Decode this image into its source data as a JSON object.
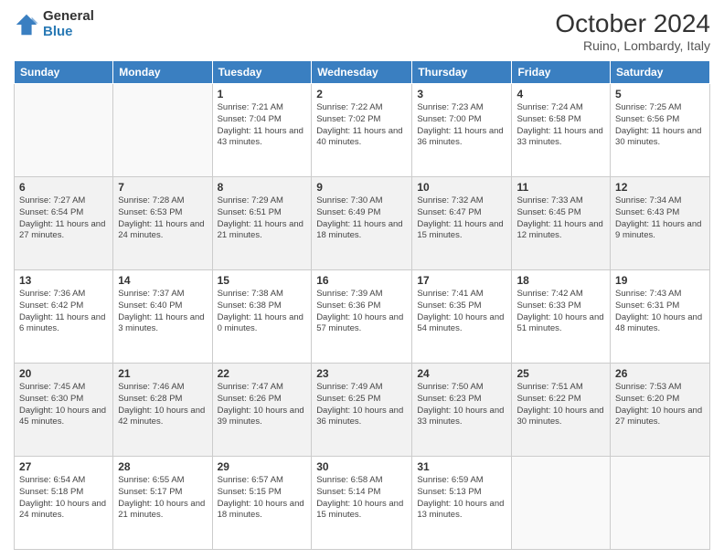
{
  "logo": {
    "general": "General",
    "blue": "Blue"
  },
  "header": {
    "title": "October 2024",
    "subtitle": "Ruino, Lombardy, Italy"
  },
  "weekdays": [
    "Sunday",
    "Monday",
    "Tuesday",
    "Wednesday",
    "Thursday",
    "Friday",
    "Saturday"
  ],
  "weeks": [
    [
      {
        "day": "",
        "sunrise": "",
        "sunset": "",
        "daylight": ""
      },
      {
        "day": "",
        "sunrise": "",
        "sunset": "",
        "daylight": ""
      },
      {
        "day": "1",
        "sunrise": "Sunrise: 7:21 AM",
        "sunset": "Sunset: 7:04 PM",
        "daylight": "Daylight: 11 hours and 43 minutes."
      },
      {
        "day": "2",
        "sunrise": "Sunrise: 7:22 AM",
        "sunset": "Sunset: 7:02 PM",
        "daylight": "Daylight: 11 hours and 40 minutes."
      },
      {
        "day": "3",
        "sunrise": "Sunrise: 7:23 AM",
        "sunset": "Sunset: 7:00 PM",
        "daylight": "Daylight: 11 hours and 36 minutes."
      },
      {
        "day": "4",
        "sunrise": "Sunrise: 7:24 AM",
        "sunset": "Sunset: 6:58 PM",
        "daylight": "Daylight: 11 hours and 33 minutes."
      },
      {
        "day": "5",
        "sunrise": "Sunrise: 7:25 AM",
        "sunset": "Sunset: 6:56 PM",
        "daylight": "Daylight: 11 hours and 30 minutes."
      }
    ],
    [
      {
        "day": "6",
        "sunrise": "Sunrise: 7:27 AM",
        "sunset": "Sunset: 6:54 PM",
        "daylight": "Daylight: 11 hours and 27 minutes."
      },
      {
        "day": "7",
        "sunrise": "Sunrise: 7:28 AM",
        "sunset": "Sunset: 6:53 PM",
        "daylight": "Daylight: 11 hours and 24 minutes."
      },
      {
        "day": "8",
        "sunrise": "Sunrise: 7:29 AM",
        "sunset": "Sunset: 6:51 PM",
        "daylight": "Daylight: 11 hours and 21 minutes."
      },
      {
        "day": "9",
        "sunrise": "Sunrise: 7:30 AM",
        "sunset": "Sunset: 6:49 PM",
        "daylight": "Daylight: 11 hours and 18 minutes."
      },
      {
        "day": "10",
        "sunrise": "Sunrise: 7:32 AM",
        "sunset": "Sunset: 6:47 PM",
        "daylight": "Daylight: 11 hours and 15 minutes."
      },
      {
        "day": "11",
        "sunrise": "Sunrise: 7:33 AM",
        "sunset": "Sunset: 6:45 PM",
        "daylight": "Daylight: 11 hours and 12 minutes."
      },
      {
        "day": "12",
        "sunrise": "Sunrise: 7:34 AM",
        "sunset": "Sunset: 6:43 PM",
        "daylight": "Daylight: 11 hours and 9 minutes."
      }
    ],
    [
      {
        "day": "13",
        "sunrise": "Sunrise: 7:36 AM",
        "sunset": "Sunset: 6:42 PM",
        "daylight": "Daylight: 11 hours and 6 minutes."
      },
      {
        "day": "14",
        "sunrise": "Sunrise: 7:37 AM",
        "sunset": "Sunset: 6:40 PM",
        "daylight": "Daylight: 11 hours and 3 minutes."
      },
      {
        "day": "15",
        "sunrise": "Sunrise: 7:38 AM",
        "sunset": "Sunset: 6:38 PM",
        "daylight": "Daylight: 11 hours and 0 minutes."
      },
      {
        "day": "16",
        "sunrise": "Sunrise: 7:39 AM",
        "sunset": "Sunset: 6:36 PM",
        "daylight": "Daylight: 10 hours and 57 minutes."
      },
      {
        "day": "17",
        "sunrise": "Sunrise: 7:41 AM",
        "sunset": "Sunset: 6:35 PM",
        "daylight": "Daylight: 10 hours and 54 minutes."
      },
      {
        "day": "18",
        "sunrise": "Sunrise: 7:42 AM",
        "sunset": "Sunset: 6:33 PM",
        "daylight": "Daylight: 10 hours and 51 minutes."
      },
      {
        "day": "19",
        "sunrise": "Sunrise: 7:43 AM",
        "sunset": "Sunset: 6:31 PM",
        "daylight": "Daylight: 10 hours and 48 minutes."
      }
    ],
    [
      {
        "day": "20",
        "sunrise": "Sunrise: 7:45 AM",
        "sunset": "Sunset: 6:30 PM",
        "daylight": "Daylight: 10 hours and 45 minutes."
      },
      {
        "day": "21",
        "sunrise": "Sunrise: 7:46 AM",
        "sunset": "Sunset: 6:28 PM",
        "daylight": "Daylight: 10 hours and 42 minutes."
      },
      {
        "day": "22",
        "sunrise": "Sunrise: 7:47 AM",
        "sunset": "Sunset: 6:26 PM",
        "daylight": "Daylight: 10 hours and 39 minutes."
      },
      {
        "day": "23",
        "sunrise": "Sunrise: 7:49 AM",
        "sunset": "Sunset: 6:25 PM",
        "daylight": "Daylight: 10 hours and 36 minutes."
      },
      {
        "day": "24",
        "sunrise": "Sunrise: 7:50 AM",
        "sunset": "Sunset: 6:23 PM",
        "daylight": "Daylight: 10 hours and 33 minutes."
      },
      {
        "day": "25",
        "sunrise": "Sunrise: 7:51 AM",
        "sunset": "Sunset: 6:22 PM",
        "daylight": "Daylight: 10 hours and 30 minutes."
      },
      {
        "day": "26",
        "sunrise": "Sunrise: 7:53 AM",
        "sunset": "Sunset: 6:20 PM",
        "daylight": "Daylight: 10 hours and 27 minutes."
      }
    ],
    [
      {
        "day": "27",
        "sunrise": "Sunrise: 6:54 AM",
        "sunset": "Sunset: 5:18 PM",
        "daylight": "Daylight: 10 hours and 24 minutes."
      },
      {
        "day": "28",
        "sunrise": "Sunrise: 6:55 AM",
        "sunset": "Sunset: 5:17 PM",
        "daylight": "Daylight: 10 hours and 21 minutes."
      },
      {
        "day": "29",
        "sunrise": "Sunrise: 6:57 AM",
        "sunset": "Sunset: 5:15 PM",
        "daylight": "Daylight: 10 hours and 18 minutes."
      },
      {
        "day": "30",
        "sunrise": "Sunrise: 6:58 AM",
        "sunset": "Sunset: 5:14 PM",
        "daylight": "Daylight: 10 hours and 15 minutes."
      },
      {
        "day": "31",
        "sunrise": "Sunrise: 6:59 AM",
        "sunset": "Sunset: 5:13 PM",
        "daylight": "Daylight: 10 hours and 13 minutes."
      },
      {
        "day": "",
        "sunrise": "",
        "sunset": "",
        "daylight": ""
      },
      {
        "day": "",
        "sunrise": "",
        "sunset": "",
        "daylight": ""
      }
    ]
  ]
}
